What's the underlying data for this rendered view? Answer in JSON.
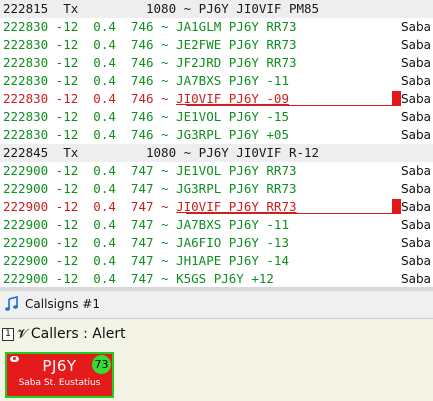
{
  "log": {
    "rows": [
      {
        "kind": "tx",
        "text": "222815  Tx         1080 ~ PJ6Y JI0VIF PM85",
        "country": ""
      },
      {
        "kind": "green",
        "text": "222830 -12  0.4  746 ~ JA1GLM PJ6Y RR73",
        "country": "Saba"
      },
      {
        "kind": "green",
        "text": "222830 -12  0.4  746 ~ JE2FWE PJ6Y RR73",
        "country": "Saba"
      },
      {
        "kind": "green",
        "text": "222830 -12  0.4  746 ~ JF2JRD PJ6Y RR73",
        "country": "Saba"
      },
      {
        "kind": "green",
        "text": "222830 -12  0.4  746 ~ JA7BXS PJ6Y -11",
        "country": "Saba"
      },
      {
        "kind": "red",
        "prefix": "222830 -12  0.4  746 ~ ",
        "msg": "JI0VIF PJ6Y -09",
        "country": "Saba"
      },
      {
        "kind": "green",
        "text": "222830 -12  0.4  746 ~ JE1VOL PJ6Y -15",
        "country": "Saba"
      },
      {
        "kind": "green",
        "text": "222830 -12  0.4  746 ~ JG3RPL PJ6Y +05",
        "country": "Saba"
      },
      {
        "kind": "tx",
        "text": "222845  Tx         1080 ~ PJ6Y JI0VIF R-12",
        "country": ""
      },
      {
        "kind": "green",
        "text": "222900 -12  0.4  747 ~ JE1VOL PJ6Y RR73",
        "country": "Saba"
      },
      {
        "kind": "green",
        "text": "222900 -12  0.4  747 ~ JG3RPL PJ6Y RR73",
        "country": "Saba"
      },
      {
        "kind": "red",
        "prefix": "222900 -12  0.4  747 ~ ",
        "msg": "JI0VIF PJ6Y RR73",
        "country": "Saba"
      },
      {
        "kind": "green",
        "text": "222900 -12  0.4  747 ~ JA7BXS PJ6Y -11",
        "country": "Saba"
      },
      {
        "kind": "green",
        "text": "222900 -12  0.4  747 ~ JA6FIO PJ6Y -13",
        "country": "Saba"
      },
      {
        "kind": "green",
        "text": "222900 -12  0.4  747 ~ JH1APE PJ6Y -14",
        "country": "Saba"
      },
      {
        "kind": "green",
        "text": "222900 -12  0.4  747 ~ K5GS PJ6Y +12",
        "country": "Saba"
      }
    ]
  },
  "tab": {
    "label": "Callsigns #1",
    "icon": "music-note-icon"
  },
  "panel": {
    "number": "1",
    "pin_icon": "pin-icon",
    "title": "Callers : Alert"
  },
  "card": {
    "callsign": "PJ6Y",
    "country": "Saba St. Eustatius",
    "badge": "73",
    "eye_icon": "eye-icon"
  },
  "colors": {
    "green": "#0f8f1f",
    "red": "#cc1f1f",
    "card_bg": "#e51a1a",
    "card_border": "#22cc22",
    "panel_bg": "#f3f3e6"
  }
}
